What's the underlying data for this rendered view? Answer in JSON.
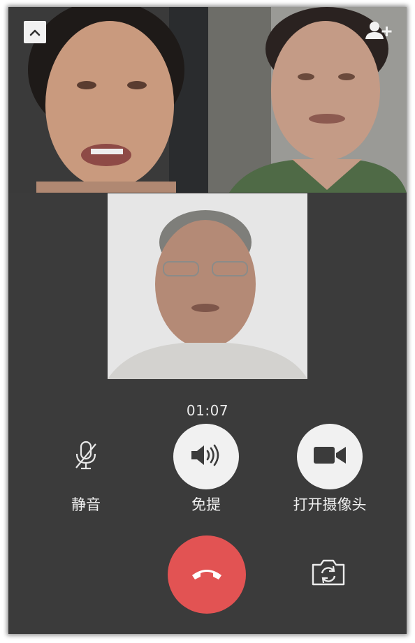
{
  "call": {
    "duration": "01:07"
  },
  "controls": {
    "mute_label": "静音",
    "speaker_label": "免提",
    "camera_label": "打开摄像头"
  },
  "icons": {
    "collapse": "chevron-up-icon",
    "add_participant": "add-user-icon",
    "mute": "microphone-off-icon",
    "speaker": "speaker-icon",
    "camera": "video-camera-icon",
    "hangup": "phone-hangup-icon",
    "switch_camera": "camera-switch-icon"
  },
  "colors": {
    "background": "#3b3b3b",
    "hangup": "#e25353",
    "button_fill": "#f1f1f1",
    "text": "#f0f0f0"
  }
}
